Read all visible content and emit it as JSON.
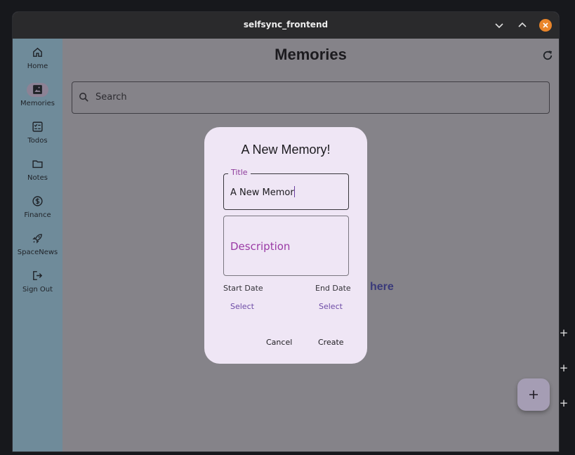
{
  "window": {
    "title": "selfsync_frontend"
  },
  "rail": {
    "items": [
      {
        "label": "Home",
        "icon": "home-icon",
        "active": false
      },
      {
        "label": "Memories",
        "icon": "image-icon",
        "active": true
      },
      {
        "label": "Todos",
        "icon": "checklist-icon",
        "active": false
      },
      {
        "label": "Notes",
        "icon": "folder-icon",
        "active": false
      },
      {
        "label": "Finance",
        "icon": "dollar-icon",
        "active": false
      },
      {
        "label": "SpaceNews",
        "icon": "rocket-icon",
        "active": false
      },
      {
        "label": "Sign Out",
        "icon": "logout-icon",
        "active": false
      }
    ]
  },
  "page": {
    "title": "Memories",
    "search_placeholder": "Search",
    "empty_message_visible": "m here!"
  },
  "dialog": {
    "title": "A New Memory!",
    "title_field": {
      "label": "Title",
      "value": "A New Memor"
    },
    "description_field": {
      "placeholder": "Description",
      "value": ""
    },
    "start_date_label": "Start Date",
    "end_date_label": "End Date",
    "start_select": "Select",
    "end_select": "Select",
    "cancel": "Cancel",
    "create": "Create"
  },
  "colors": {
    "rail_bg": "#6f8b9a",
    "content_scrim": "#858389",
    "dialog_bg": "#efe6f5",
    "accent": "#8d3b9a",
    "close_button": "#e9852a"
  }
}
